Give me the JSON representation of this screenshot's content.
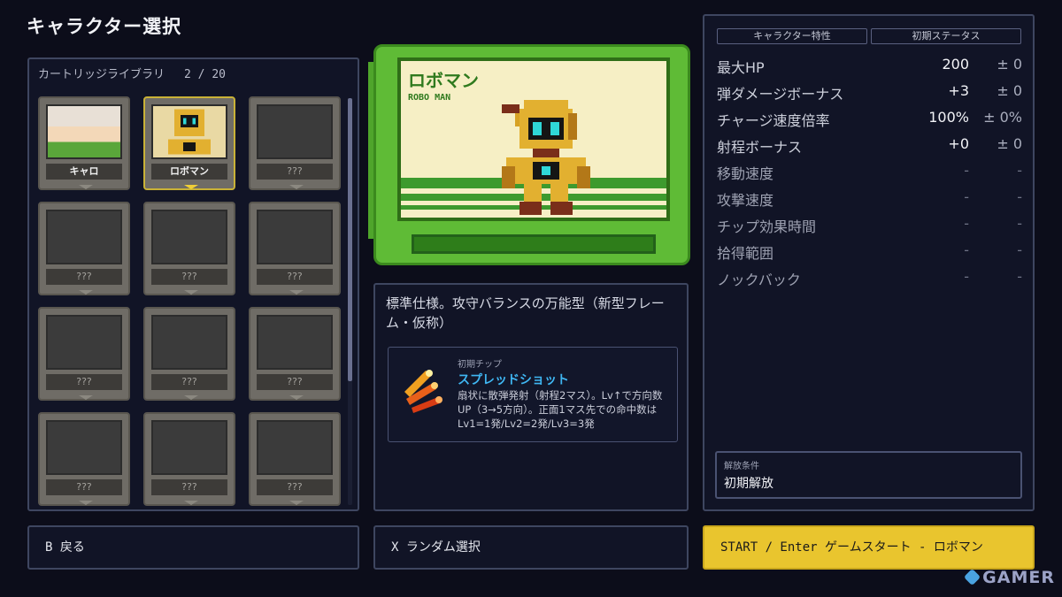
{
  "screen_title": "キャラクター選択",
  "library": {
    "title": "カートリッジライブラリ",
    "count": "2 / 20",
    "slots": [
      {
        "label": "キャロ",
        "state": "unlocked"
      },
      {
        "label": "ロボマン",
        "state": "selected"
      },
      {
        "label": "???",
        "state": "locked"
      },
      {
        "label": "???",
        "state": "locked"
      },
      {
        "label": "???",
        "state": "locked"
      },
      {
        "label": "???",
        "state": "locked"
      },
      {
        "label": "???",
        "state": "locked"
      },
      {
        "label": "???",
        "state": "locked"
      },
      {
        "label": "???",
        "state": "locked"
      },
      {
        "label": "???",
        "state": "locked"
      },
      {
        "label": "???",
        "state": "locked"
      },
      {
        "label": "???",
        "state": "locked"
      }
    ]
  },
  "cartridge": {
    "name": "ロボマン",
    "name_en": "ROBO MAN",
    "color": "#5fbb36"
  },
  "description": {
    "text": "標準仕様。攻守バランスの万能型（新型フレーム・仮称）",
    "chip_caption": "初期チップ",
    "chip_name": "スプレッドショット",
    "chip_desc": "扇状に散弾発射（射程2マス）。Lv↑で方向数UP（3→5方向）。正面1マス先での命中数はLv1=1発/Lv2=2発/Lv3=3発",
    "chip_icon": "spread-shot-icon"
  },
  "stats": {
    "tabs": [
      "キャラクター特性",
      "初期ステータス"
    ],
    "rows": [
      {
        "name": "最大HP",
        "value": "200",
        "delta": "± 0",
        "dim": false
      },
      {
        "name": "弾ダメージボーナス",
        "value": "+3",
        "delta": "± 0",
        "dim": false
      },
      {
        "name": "チャージ速度倍率",
        "value": "100%",
        "delta": "± 0%",
        "dim": false
      },
      {
        "name": "射程ボーナス",
        "value": "+0",
        "delta": "± 0",
        "dim": false
      },
      {
        "name": "移動速度",
        "value": "-",
        "delta": "-",
        "dim": true
      },
      {
        "name": "攻撃速度",
        "value": "-",
        "delta": "-",
        "dim": true
      },
      {
        "name": "チップ効果時間",
        "value": "-",
        "delta": "-",
        "dim": true
      },
      {
        "name": "拾得範囲",
        "value": "-",
        "delta": "-",
        "dim": true
      },
      {
        "name": "ノックバック",
        "value": "-",
        "delta": "-",
        "dim": true
      }
    ],
    "unlock_caption": "解放条件",
    "unlock_value": "初期解放"
  },
  "buttons": {
    "back": "B 戻る",
    "random": "X ランダム選択",
    "start": "START / Enter ゲームスタート - ロボマン"
  },
  "watermark": "GAMER"
}
